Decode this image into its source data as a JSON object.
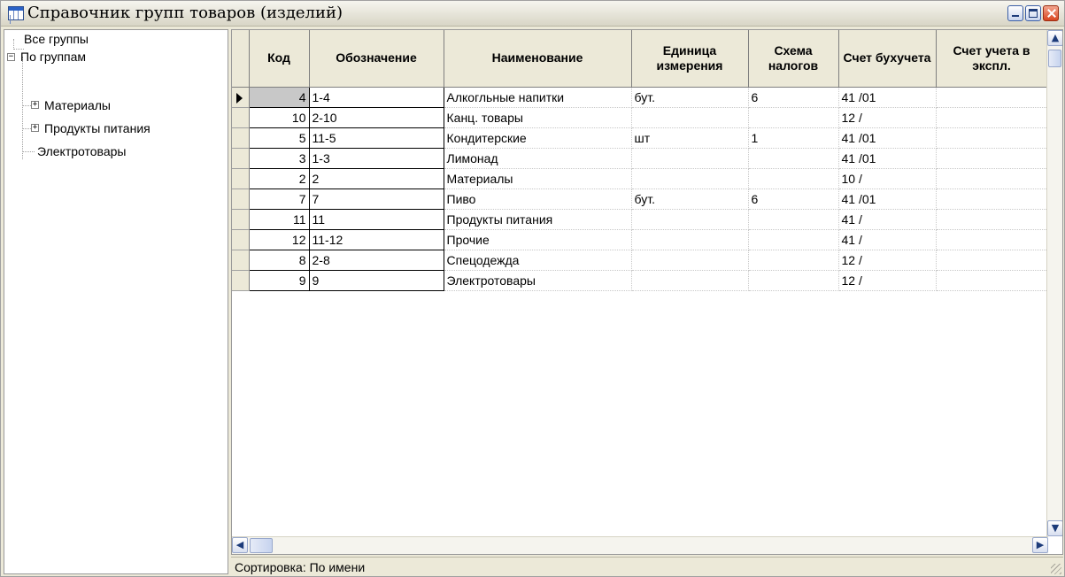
{
  "window": {
    "title": "Справочник групп товаров (изделий)",
    "icon": "table-icon"
  },
  "tree": {
    "items": [
      {
        "label": "Все группы",
        "level": 0,
        "expander": null
      },
      {
        "label": "По группам",
        "level": 0,
        "expander": "minus"
      },
      {
        "label": "Материалы",
        "level": 1,
        "expander": "plus"
      },
      {
        "label": "Продукты питания",
        "level": 1,
        "expander": "plus"
      },
      {
        "label": "Электротовары",
        "level": 1,
        "expander": null
      }
    ]
  },
  "grid": {
    "columns": [
      {
        "label": "Код"
      },
      {
        "label": "Обозначение"
      },
      {
        "label": "Наименование"
      },
      {
        "label": "Единица измерения"
      },
      {
        "label": "Схема налогов"
      },
      {
        "label": "Счет бухучета"
      },
      {
        "label": "Счет учета в экспл."
      }
    ],
    "selected_row": 0,
    "rows": [
      {
        "code": "4",
        "designation": "1-4",
        "name": "Алкогльные напитки",
        "unit": "бут.",
        "tax_scheme": "6",
        "account": "41 /01",
        "account_expl": ""
      },
      {
        "code": "10",
        "designation": "2-10",
        "name": "Канц. товары",
        "unit": "",
        "tax_scheme": "",
        "account": "12 /",
        "account_expl": ""
      },
      {
        "code": "5",
        "designation": "11-5",
        "name": "Кондитерские",
        "unit": "шт",
        "tax_scheme": "1",
        "account": "41 /01",
        "account_expl": ""
      },
      {
        "code": "3",
        "designation": "1-3",
        "name": "Лимонад",
        "unit": "",
        "tax_scheme": "",
        "account": "41 /01",
        "account_expl": ""
      },
      {
        "code": "2",
        "designation": "2",
        "name": "Материалы",
        "unit": "",
        "tax_scheme": "",
        "account": "10 /",
        "account_expl": ""
      },
      {
        "code": "7",
        "designation": "7",
        "name": "Пиво",
        "unit": "бут.",
        "tax_scheme": "6",
        "account": "41 /01",
        "account_expl": ""
      },
      {
        "code": "11",
        "designation": "11",
        "name": "Продукты питания",
        "unit": "",
        "tax_scheme": "",
        "account": "41 /",
        "account_expl": ""
      },
      {
        "code": "12",
        "designation": "11-12",
        "name": "Прочие",
        "unit": "",
        "tax_scheme": "",
        "account": "41 /",
        "account_expl": ""
      },
      {
        "code": "8",
        "designation": "2-8",
        "name": "Спецодежда",
        "unit": "",
        "tax_scheme": "",
        "account": "12 /",
        "account_expl": ""
      },
      {
        "code": "9",
        "designation": "9",
        "name": "Электротовары",
        "unit": "",
        "tax_scheme": "",
        "account": "12 /",
        "account_expl": ""
      }
    ]
  },
  "statusbar": {
    "text": "Сортировка: По имени"
  }
}
